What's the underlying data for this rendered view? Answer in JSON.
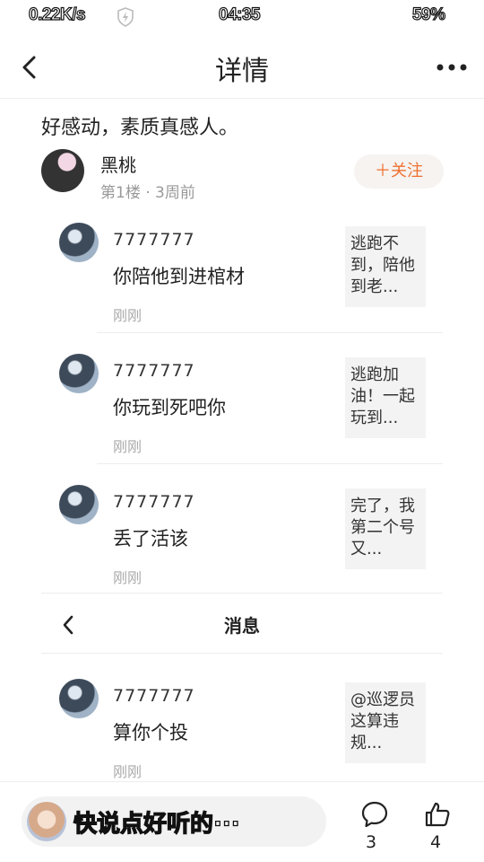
{
  "status_bar": {
    "net_speed": "0.22K/s",
    "time": "04:35",
    "battery": "59%"
  },
  "header": {
    "title": "详情"
  },
  "post": {
    "text": "好感动，素质真感人。",
    "author": "黑桃",
    "meta": "第1楼 · 3周前",
    "follow_label": "＋关注"
  },
  "replies": [
    {
      "name": "7777777",
      "text": "你陪他到进棺材",
      "time": "刚刚",
      "quote": "逃跑不到，陪他到老..."
    },
    {
      "name": "7777777",
      "text": "你玩到死吧你",
      "time": "刚刚",
      "quote": "逃跑加油！一起玩到..."
    },
    {
      "name": "7777777",
      "text": "丢了活该",
      "time": "刚刚",
      "quote": "完了，我第二个号又..."
    },
    {
      "name": "7777777",
      "text": "算你个投",
      "time": "刚刚",
      "quote": "@巡逻员 这算违规..."
    }
  ],
  "message_bar": {
    "title": "消息"
  },
  "bottom_bar": {
    "placeholder": "快说点好听的···",
    "comment_count": "3",
    "like_count": "4"
  }
}
